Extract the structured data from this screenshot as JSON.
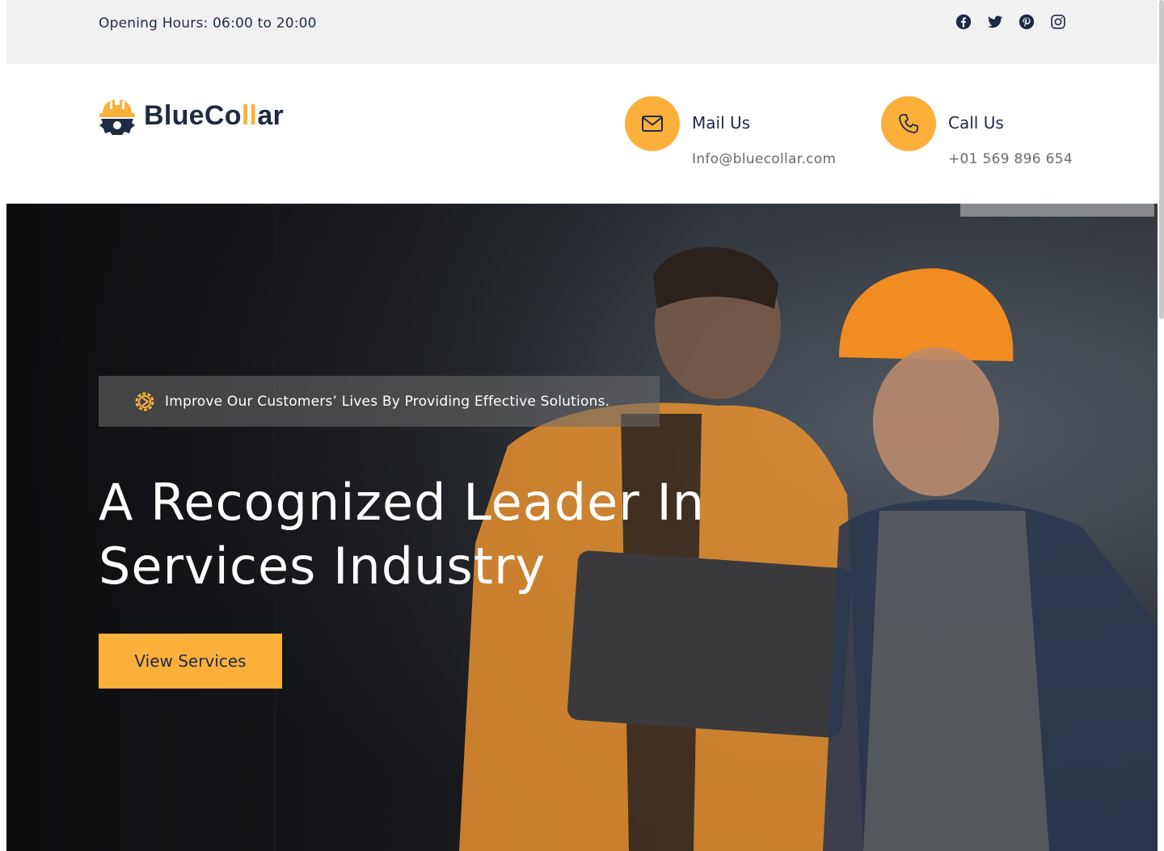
{
  "topbar": {
    "hours": "Opening Hours: 06:00 to 20:00",
    "socials": [
      "facebook-icon",
      "twitter-icon",
      "pinterest-icon",
      "instagram-icon"
    ]
  },
  "header": {
    "logo": {
      "text_before": "BlueCo",
      "text_accent": "ll",
      "text_after": "ar"
    },
    "mail": {
      "title": "Mail Us",
      "value": "Info@bluecollar.com",
      "icon": "mail-icon"
    },
    "call": {
      "title": "Call Us",
      "value": "+01 569 896 654",
      "icon": "phone-icon"
    }
  },
  "hero": {
    "tagline": "Improve Our Customers’ Lives By Providing Effective Solutions.",
    "title_line1": "A Recognized Leader In",
    "title_line2": "Services Industry",
    "button": "View Services",
    "background": "two-industrial-workers-with-laptop-photo"
  },
  "colors": {
    "accent": "#fbb03b",
    "navy": "#1f2a44",
    "topbar_bg": "#f1f1f1"
  }
}
